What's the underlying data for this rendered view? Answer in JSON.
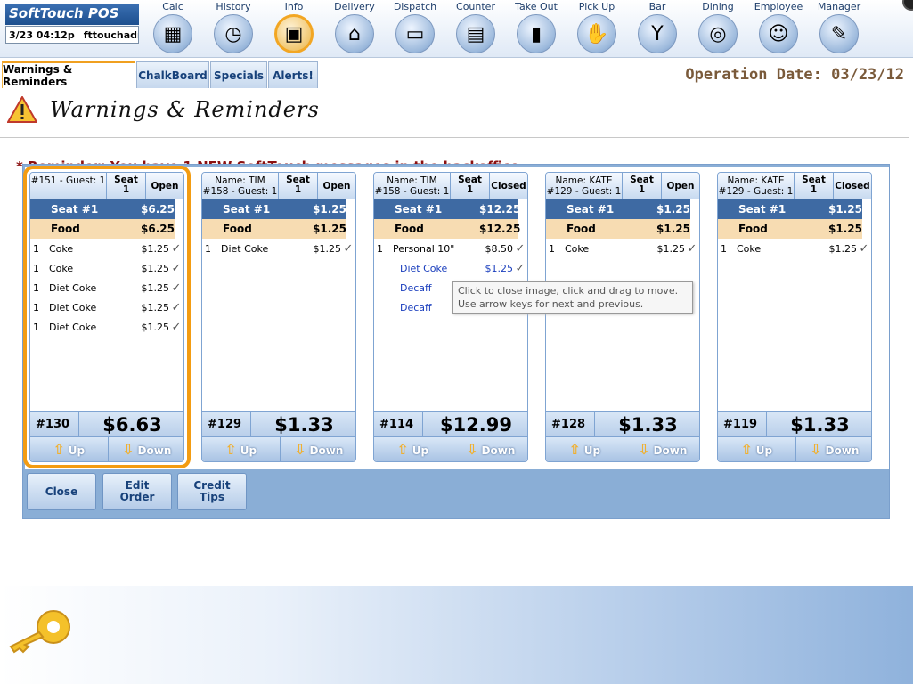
{
  "app": {
    "title": "SoftTouch POS",
    "date_time": "3/23 04:12p",
    "user": "fttouchadm"
  },
  "nav": [
    {
      "label": "Calc",
      "icon": "calculator-icon"
    },
    {
      "label": "History",
      "icon": "clock-icon"
    },
    {
      "label": "Info",
      "icon": "chalkboard-icon"
    },
    {
      "label": "Delivery",
      "icon": "house-icon"
    },
    {
      "label": "Dispatch",
      "icon": "car-icon"
    },
    {
      "label": "Counter",
      "icon": "cash-register-icon"
    },
    {
      "label": "Take Out",
      "icon": "bag-icon"
    },
    {
      "label": "Pick Up",
      "icon": "pickup-icon"
    },
    {
      "label": "Bar",
      "icon": "cocktail-icon"
    },
    {
      "label": "Dining",
      "icon": "plate-icon"
    },
    {
      "label": "Employee",
      "icon": "employees-icon"
    },
    {
      "label": "Manager",
      "icon": "manager-icon"
    }
  ],
  "tabs": [
    "Warnings & Reminders",
    "ChalkBoard",
    "Specials",
    "Alerts!"
  ],
  "operation_date": "Operation Date: 03/23/12",
  "section_title": "Warnings & Reminders",
  "reminder": "* Reminder: You have 1 NEW SoftTouch messages in the backoffice",
  "checks": [
    {
      "header": "#151 - Guest: 1",
      "seat_label": "Seat",
      "seat_num": "1",
      "status": "Open",
      "seat_row": {
        "name": "Seat #1",
        "price": "$6.25"
      },
      "food_row": {
        "name": "Food",
        "price": "$6.25"
      },
      "items": [
        {
          "qty": "1",
          "name": "Coke",
          "price": "$1.25"
        },
        {
          "qty": "1",
          "name": "Coke",
          "price": "$1.25"
        },
        {
          "qty": "1",
          "name": "Diet Coke",
          "price": "$1.25"
        },
        {
          "qty": "1",
          "name": "Diet Coke",
          "price": "$1.25"
        },
        {
          "qty": "1",
          "name": "Diet Coke",
          "price": "$1.25"
        }
      ],
      "number": "#130",
      "total": "$6.63"
    },
    {
      "header": "Name: TIM\n#158 - Guest: 1",
      "seat_label": "Seat",
      "seat_num": "1",
      "status": "Open",
      "seat_row": {
        "name": "Seat #1",
        "price": "$1.25"
      },
      "food_row": {
        "name": "Food",
        "price": "$1.25"
      },
      "items": [
        {
          "qty": "1",
          "name": "Diet Coke",
          "price": "$1.25"
        }
      ],
      "number": "#129",
      "total": "$1.33"
    },
    {
      "header": "Name: TIM\n#158 - Guest: 1",
      "seat_label": "Seat",
      "seat_num": "1",
      "status": "Closed",
      "seat_row": {
        "name": "Seat #1",
        "price": "$12.25"
      },
      "food_row": {
        "name": "Food",
        "price": "$12.25"
      },
      "items": [
        {
          "qty": "1",
          "name": "Personal 10\"",
          "price": "$8.50"
        },
        {
          "qty": "",
          "name": "Diet Coke",
          "price": "$1.25",
          "sub": true
        },
        {
          "qty": "",
          "name": "Decaff",
          "price": "",
          "sub": true
        },
        {
          "qty": "",
          "name": "Decaff",
          "price": "",
          "sub": true
        }
      ],
      "number": "#114",
      "total": "$12.99"
    },
    {
      "header": "Name: KATE\n#129 - Guest: 1",
      "seat_label": "Seat",
      "seat_num": "1",
      "status": "Open",
      "seat_row": {
        "name": "Seat #1",
        "price": "$1.25"
      },
      "food_row": {
        "name": "Food",
        "price": "$1.25"
      },
      "items": [
        {
          "qty": "1",
          "name": "Coke",
          "price": "$1.25"
        }
      ],
      "number": "#128",
      "total": "$1.33"
    },
    {
      "header": "Name: KATE\n#129 - Guest: 1",
      "seat_label": "Seat",
      "seat_num": "1",
      "status": "Closed",
      "seat_row": {
        "name": "Seat #1",
        "price": "$1.25"
      },
      "food_row": {
        "name": "Food",
        "price": "$1.25"
      },
      "items": [
        {
          "qty": "1",
          "name": "Coke",
          "price": "$1.25"
        }
      ],
      "number": "#119",
      "total": "$1.33"
    }
  ],
  "check_buttons": {
    "up": "Up",
    "down": "Down"
  },
  "actions": {
    "close": "Close",
    "edit_order": "Edit Order",
    "credit_tips": "Credit Tips"
  },
  "tooltip": "Click to close image, click and drag to move. Use arrow keys for next and previous."
}
